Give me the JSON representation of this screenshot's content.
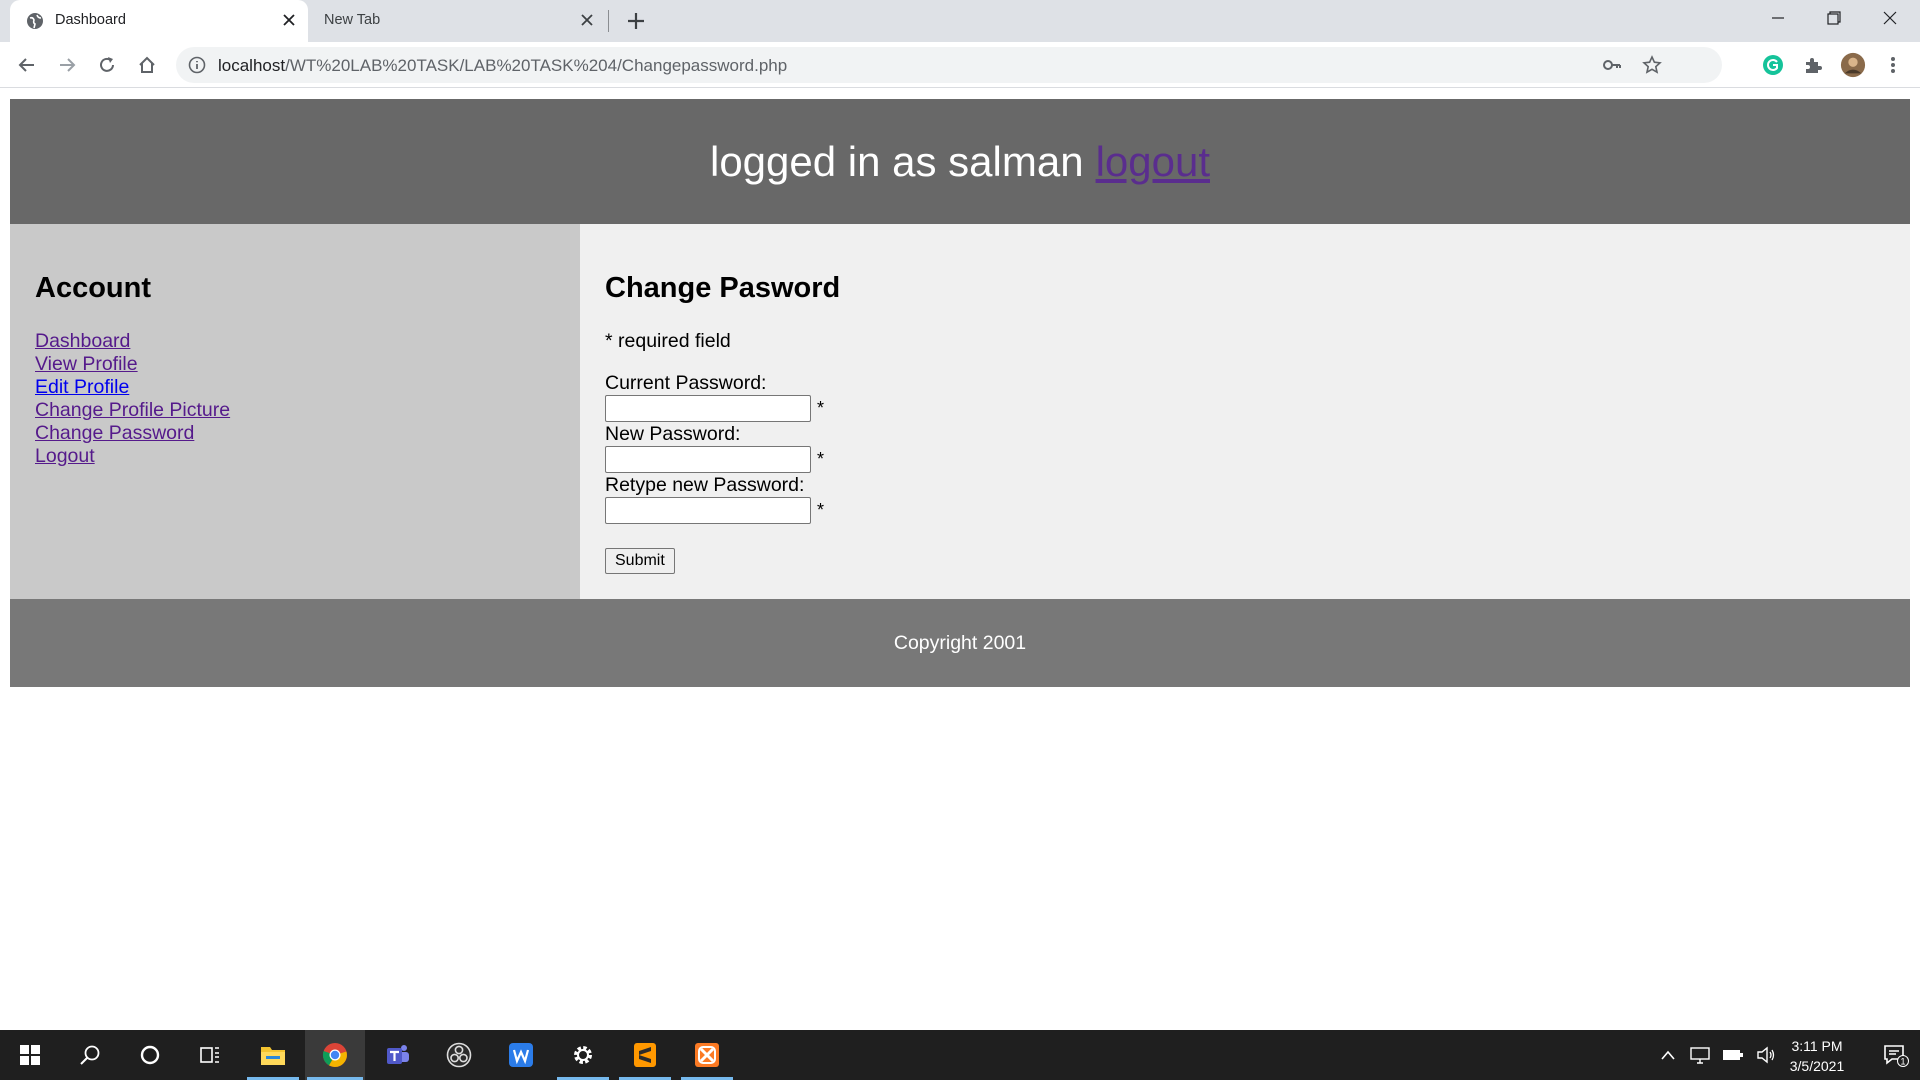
{
  "browser": {
    "tabs": [
      {
        "title": "Dashboard",
        "active": true
      },
      {
        "title": "New Tab",
        "active": false
      }
    ],
    "url_host": "localhost",
    "url_path": "/WT%20LAB%20TASK/LAB%20TASK%204/Changepassword.php"
  },
  "header": {
    "text": "logged in as salman",
    "logout_link": "logout"
  },
  "sidebar": {
    "title": "Account",
    "links": [
      {
        "label": "Dashboard"
      },
      {
        "label": "View Profile"
      },
      {
        "label": "Edit Profile"
      },
      {
        "label": "Change Profile Picture"
      },
      {
        "label": "Change Password"
      },
      {
        "label": "Logout"
      }
    ]
  },
  "form": {
    "title": "Change Pasword",
    "required_note": "* required field",
    "fields": [
      {
        "label": "Current Password:",
        "value": "",
        "marker": "*"
      },
      {
        "label": "New Password:",
        "value": "",
        "marker": "*"
      },
      {
        "label": "Retype new Password:",
        "value": "",
        "marker": "*"
      }
    ],
    "submit_label": "Submit"
  },
  "footer": {
    "text": "Copyright 2001"
  },
  "taskbar": {
    "time": "3:11 PM",
    "date": "3/5/2021",
    "notification_count": "1"
  },
  "colors": {
    "header_bg": "#686868",
    "sidebar_bg": "#c9c9c9",
    "main_bg": "#f0f0f0",
    "footer_bg": "#787878",
    "visited_link": "#551a8b",
    "link": "#0000ee"
  }
}
